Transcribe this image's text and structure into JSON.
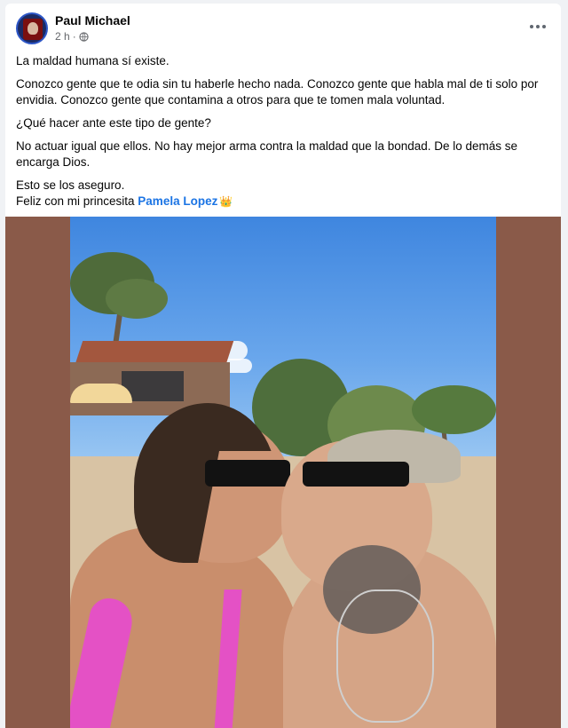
{
  "post": {
    "author": "Paul Michael",
    "time": "2 h",
    "dot": "·",
    "paragraphs": [
      "La maldad humana sí existe.",
      "Conozco gente que te odia sin tu haberle hecho nada. Conozco gente que habla mal de ti solo por envidia. Conozco gente que contamina a otros para que te tomen mala voluntad.",
      "¿Qué hacer ante este tipo de gente?",
      "No actuar igual que ellos. No hay mejor arma contra la maldad que la bondad. De lo demás se encarga Dios."
    ],
    "closing_line": "Esto se los aseguro.",
    "tag_line_prefix": "Feliz con mi princesita ",
    "tagged_person": "Pamela Lopez",
    "emoji": "👑"
  },
  "icons": {
    "privacy": "globe-icon",
    "menu": "more-options-icon"
  },
  "colors": {
    "mention": "#1b74e4",
    "media_background": "#8a5a49",
    "bikini": "#e451c5"
  }
}
